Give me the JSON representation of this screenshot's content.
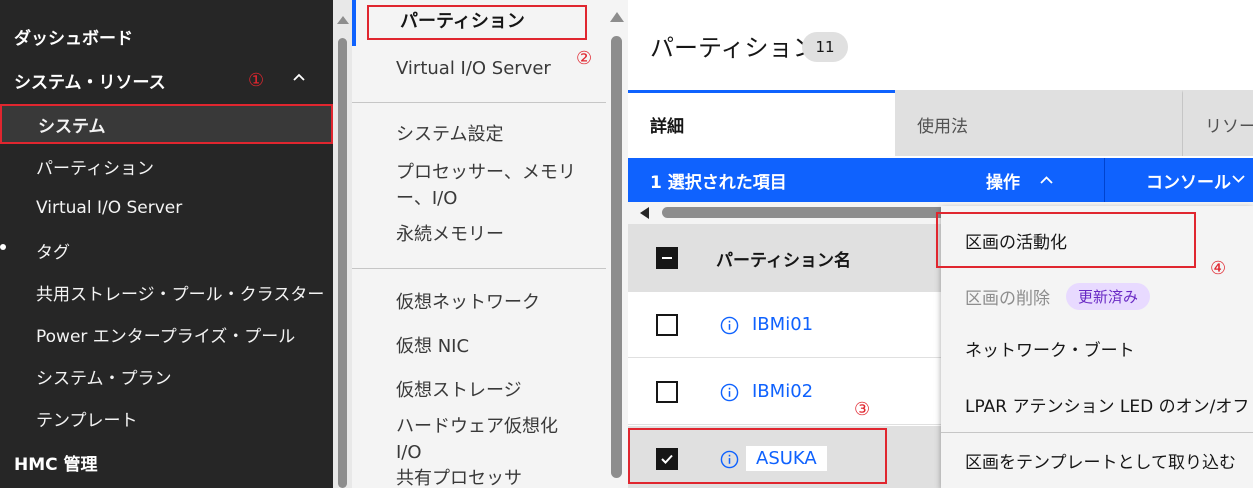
{
  "sidebar": {
    "dashboard": "ダッシュボード",
    "system_resources": "システム・リソース",
    "items": [
      {
        "label": "システム"
      },
      {
        "label": "パーティション"
      },
      {
        "label": "Virtual I/O Server"
      },
      {
        "label": "タグ"
      },
      {
        "label": "共用ストレージ・プール・クラスター"
      },
      {
        "label": "Power エンタープライズ・プール"
      },
      {
        "label": "システム・プラン"
      },
      {
        "label": "テンプレート"
      }
    ],
    "hmc_management": "HMC 管理"
  },
  "midmenu": {
    "items": [
      {
        "label": "パーティション"
      },
      {
        "label": "Virtual I/O Server"
      },
      {
        "label": "システム設定"
      },
      {
        "label": "プロセッサー、メモリ"
      },
      {
        "label": "ー、I/O"
      },
      {
        "label": "永続メモリー"
      },
      {
        "label": "仮想ネットワーク"
      },
      {
        "label": "仮想 NIC"
      },
      {
        "label": "仮想ストレージ"
      },
      {
        "label": "ハードウェア仮想化"
      },
      {
        "label": "I/O"
      },
      {
        "label": "共有プロセッサ"
      }
    ]
  },
  "main": {
    "title": "パーティション",
    "count": "11",
    "tabs": [
      {
        "label": "詳細"
      },
      {
        "label": "使用法"
      },
      {
        "label": "リソース"
      }
    ],
    "action_bar": {
      "selected": "1 選択された項目",
      "operations": "操作",
      "console": "コンソール"
    },
    "table": {
      "column_name": "パーティション名",
      "rows": [
        {
          "name": "IBMi01",
          "checked": false
        },
        {
          "name": "IBMi02",
          "checked": false
        },
        {
          "name": "ASUKA",
          "checked": true
        }
      ]
    }
  },
  "dropdown": {
    "items": [
      {
        "label": "区画の活動化"
      },
      {
        "label": "区画の削除",
        "tag": "更新済み"
      },
      {
        "label": "ネットワーク・ブート"
      },
      {
        "label": "LPAR アテンション LED のオン/オフ"
      },
      {
        "label": "区画をテンプレートとして取り込む"
      }
    ]
  },
  "annotations": {
    "a1": "①",
    "a2": "②",
    "a3": "③",
    "a4": "④"
  },
  "colors": {
    "sidebar_bg": "#262626",
    "accent_blue": "#0f62fe",
    "annotation_red": "#e0262f",
    "tag_purple_bg": "#e8daff",
    "tag_purple_fg": "#6929c4"
  }
}
